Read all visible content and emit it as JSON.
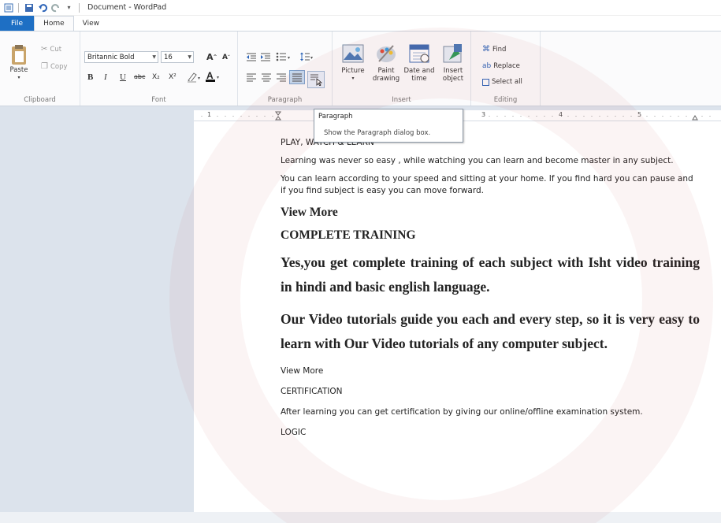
{
  "window": {
    "title": "Document - WordPad"
  },
  "tabs": [
    "File",
    "Home",
    "View"
  ],
  "clipboard": {
    "paste": "Paste",
    "cut": "Cut",
    "copy": "Copy",
    "label": "Clipboard"
  },
  "font": {
    "family": "Britannic Bold",
    "size": "16",
    "label": "Font",
    "bold": "B",
    "italic": "I",
    "underline": "U",
    "strike": "abc",
    "subscript": "X₂",
    "superscript": "X²"
  },
  "paragraph": {
    "label": "Paragraph"
  },
  "insert": {
    "label": "Insert",
    "picture": "Picture",
    "paint": [
      "Paint",
      "drawing"
    ],
    "datetime": [
      "Date and",
      "time"
    ],
    "object": [
      "Insert",
      "object"
    ]
  },
  "editing": {
    "label": "Editing",
    "find": "Find",
    "replace": "Replace",
    "select_all": "Select all"
  },
  "ruler": [
    "1",
    "3",
    "4",
    "5"
  ],
  "tooltip": {
    "title": "Paragraph",
    "desc": "Show the Paragraph dialog box."
  },
  "document": {
    "line1": "PLAY, WATCH & LEARN",
    "line2": "Learning was never so easy , while watching you can learn and become master in any subject.",
    "line3": "You can learn according to your speed and sitting at your home. If you find hard you can pause and if you find subject is easy you can move forward.",
    "h1": "View More",
    "h2": "COMPLETE TRAINING",
    "h3": "Yes,you get complete training of each subject with Isht video training in hindi and basic english language.",
    "h4": "Our Video tutorials guide you each and every step, so it is very easy to learn with Our Video tutorials of any computer subject.",
    "line4": "View More",
    "line5": "CERTIFICATION",
    "line6": "After learning you can get certification by giving our online/offline examination system.",
    "line7": "LOGIC"
  }
}
